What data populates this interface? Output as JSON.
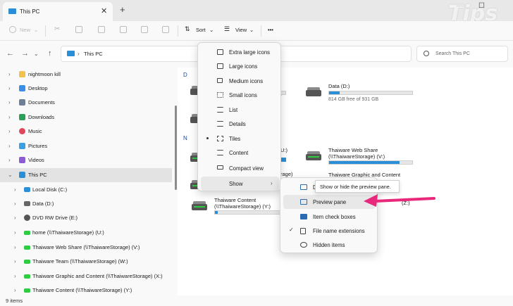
{
  "window": {
    "tab_title": "This PC",
    "new_tab": "+",
    "minimize": "—",
    "maximize": "☐"
  },
  "toolbar": {
    "new": "New",
    "sort": "Sort",
    "view": "View",
    "more": "•••"
  },
  "address": {
    "path": "This PC",
    "search_placeholder": "Search This PC"
  },
  "sidebar": {
    "items": [
      {
        "label": "nightmoon kill",
        "color": "#f2c14e"
      },
      {
        "label": "Desktop",
        "color": "#3a8ee6"
      },
      {
        "label": "Documents",
        "color": "#6d7f95"
      },
      {
        "label": "Downloads",
        "color": "#2e9e5b"
      },
      {
        "label": "Music",
        "color": "#e0465c"
      },
      {
        "label": "Pictures",
        "color": "#3aa0e0"
      },
      {
        "label": "Videos",
        "color": "#8e5bd6"
      },
      {
        "label": "This PC",
        "color": "#2b8fd8"
      },
      {
        "label": "Local Disk (C:)",
        "color": "#2b8fd8"
      },
      {
        "label": "Data (D:)",
        "color": "#666666"
      },
      {
        "label": "DVD RW Drive (E:)",
        "color": "#555555"
      },
      {
        "label": "home (\\\\ThaiwareStorage) (U:)",
        "color": "#2ecc40"
      },
      {
        "label": "Thaiware Web Share (\\\\ThaiwareStorage) (V:)",
        "color": "#2ecc40"
      },
      {
        "label": "Thaiware Team (\\\\ThaiwareStorage) (W:)",
        "color": "#2ecc40"
      },
      {
        "label": "Thaiware Graphic and Content (\\\\ThaiwareStorage) (X:)",
        "color": "#2ecc40"
      },
      {
        "label": "Thaiware Content (\\\\ThaiwareStorage) (Y:)",
        "color": "#2ecc40"
      }
    ]
  },
  "main": {
    "group_devices": "D",
    "group_network": "N",
    "drives": [
      {
        "name": "Data (D:)",
        "free": "814 GB free of 931 GB",
        "fill": 0.13
      },
      {
        "name": "Thaiware Web Share",
        "sub": "(\\\\ThaiwareStorage) (V:)",
        "fill": 0.85
      },
      {
        "name": "Thaiware Graphic and Content",
        "fill": 0.0
      },
      {
        "name": "Thaiware Content",
        "sub": "(\\\\ThaiwareStorage) (Y:)",
        "fill": 0.03
      }
    ],
    "partials": {
      "u": "U:)",
      "w": "rage)",
      "z": "(Z:)"
    }
  },
  "view_menu": {
    "items": [
      "Extra large icons",
      "Large icons",
      "Medium icons",
      "Small icons",
      "List",
      "Details",
      "Tiles",
      "Content",
      "Compact view",
      "Show"
    ],
    "selected": "Tiles"
  },
  "show_menu": {
    "items": [
      "Details pane",
      "Preview pane",
      "Item check boxes",
      "File name extensions",
      "Hidden items"
    ],
    "partial_first": "D",
    "checked": "File name extensions"
  },
  "tooltip": {
    "text": "Show or hide the preview pane."
  },
  "status": {
    "items_count": "9 items"
  },
  "watermark": {
    "text": "Tips"
  },
  "colors": {
    "accent": "#2b8fd8",
    "arrow": "#e8287a"
  }
}
